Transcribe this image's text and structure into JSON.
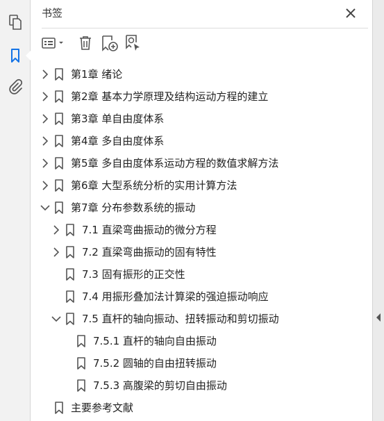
{
  "rail": {
    "items": [
      {
        "name": "pages-icon",
        "label": "Pages"
      },
      {
        "name": "bookmark-icon",
        "label": "Bookmarks"
      },
      {
        "name": "attachment-icon",
        "label": "Attachments"
      }
    ]
  },
  "panel": {
    "title": "书签",
    "toolbar": [
      "options-menu-icon",
      "delete-icon",
      "new-bookmark-icon",
      "find-bookmark-icon"
    ]
  },
  "bookmarks": [
    {
      "label": "第1章 绪论",
      "level": 0,
      "state": "collapsed"
    },
    {
      "label": "第2章 基本力学原理及结构运动方程的建立",
      "level": 0,
      "state": "collapsed"
    },
    {
      "label": "第3章 单自由度体系",
      "level": 0,
      "state": "collapsed"
    },
    {
      "label": "第4章 多自由度体系",
      "level": 0,
      "state": "collapsed"
    },
    {
      "label": "第5章 多自由度体系运动方程的数值求解方法",
      "level": 0,
      "state": "collapsed"
    },
    {
      "label": "第6章 大型系统分析的实用计算方法",
      "level": 0,
      "state": "collapsed"
    },
    {
      "label": "第7章 分布参数系统的振动",
      "level": 0,
      "state": "expanded"
    },
    {
      "label": "7.1 直梁弯曲振动的微分方程",
      "level": 1,
      "state": "collapsed"
    },
    {
      "label": "7.2 直梁弯曲振动的固有特性",
      "level": 1,
      "state": "collapsed"
    },
    {
      "label": "7.3 固有振形的正交性",
      "level": 1,
      "state": "leaf"
    },
    {
      "label": "7.4 用振形叠加法计算梁的强迫振动响应",
      "level": 1,
      "state": "leaf"
    },
    {
      "label": "7.5 直杆的轴向振动、扭转振动和剪切振动",
      "level": 1,
      "state": "expanded"
    },
    {
      "label": "7.5.1 直杆的轴向自由振动",
      "level": 2,
      "state": "leaf"
    },
    {
      "label": "7.5.2 圆轴的自由扭转振动",
      "level": 2,
      "state": "leaf"
    },
    {
      "label": "7.5.3 高腹梁的剪切自由振动",
      "level": 2,
      "state": "leaf"
    },
    {
      "label": "主要参考文献",
      "level": 0,
      "state": "leaf"
    }
  ],
  "colors": {
    "accent": "#1473e6",
    "icon": "#555555",
    "rail_bg": "#f2f2f2"
  }
}
